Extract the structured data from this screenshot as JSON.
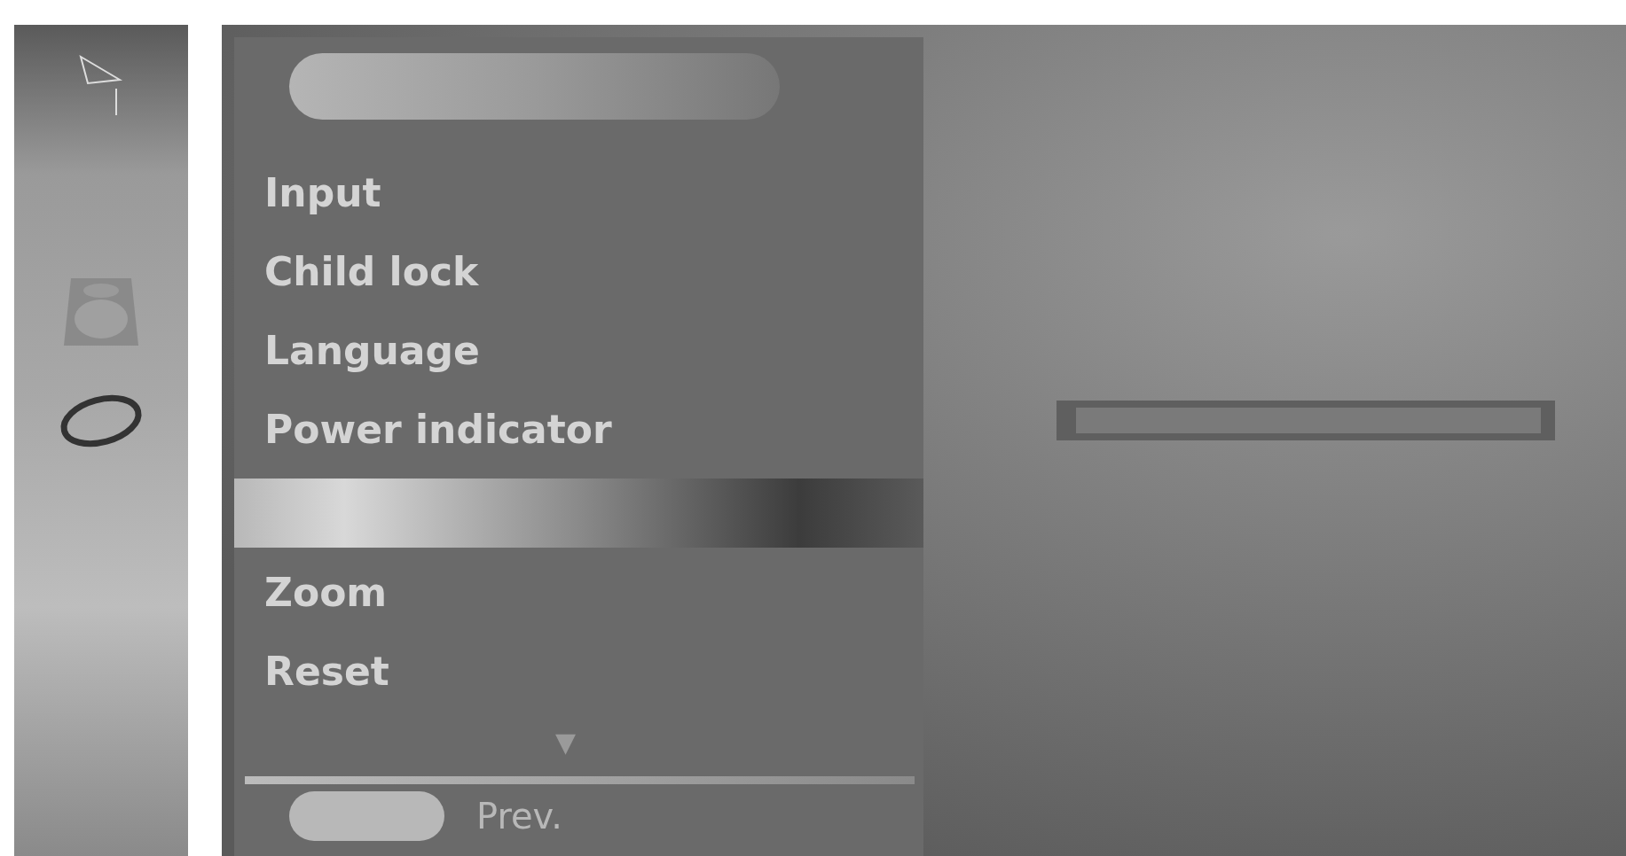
{
  "menu": {
    "upper_items": [
      {
        "label": "Input"
      },
      {
        "label": "Child lock"
      },
      {
        "label": "Language"
      },
      {
        "label": "Power indicator"
      }
    ],
    "lower_items": [
      {
        "label": "Zoom"
      },
      {
        "label": "Reset"
      }
    ],
    "scroll_arrow": "▼",
    "footer": {
      "label": "Prev."
    }
  }
}
